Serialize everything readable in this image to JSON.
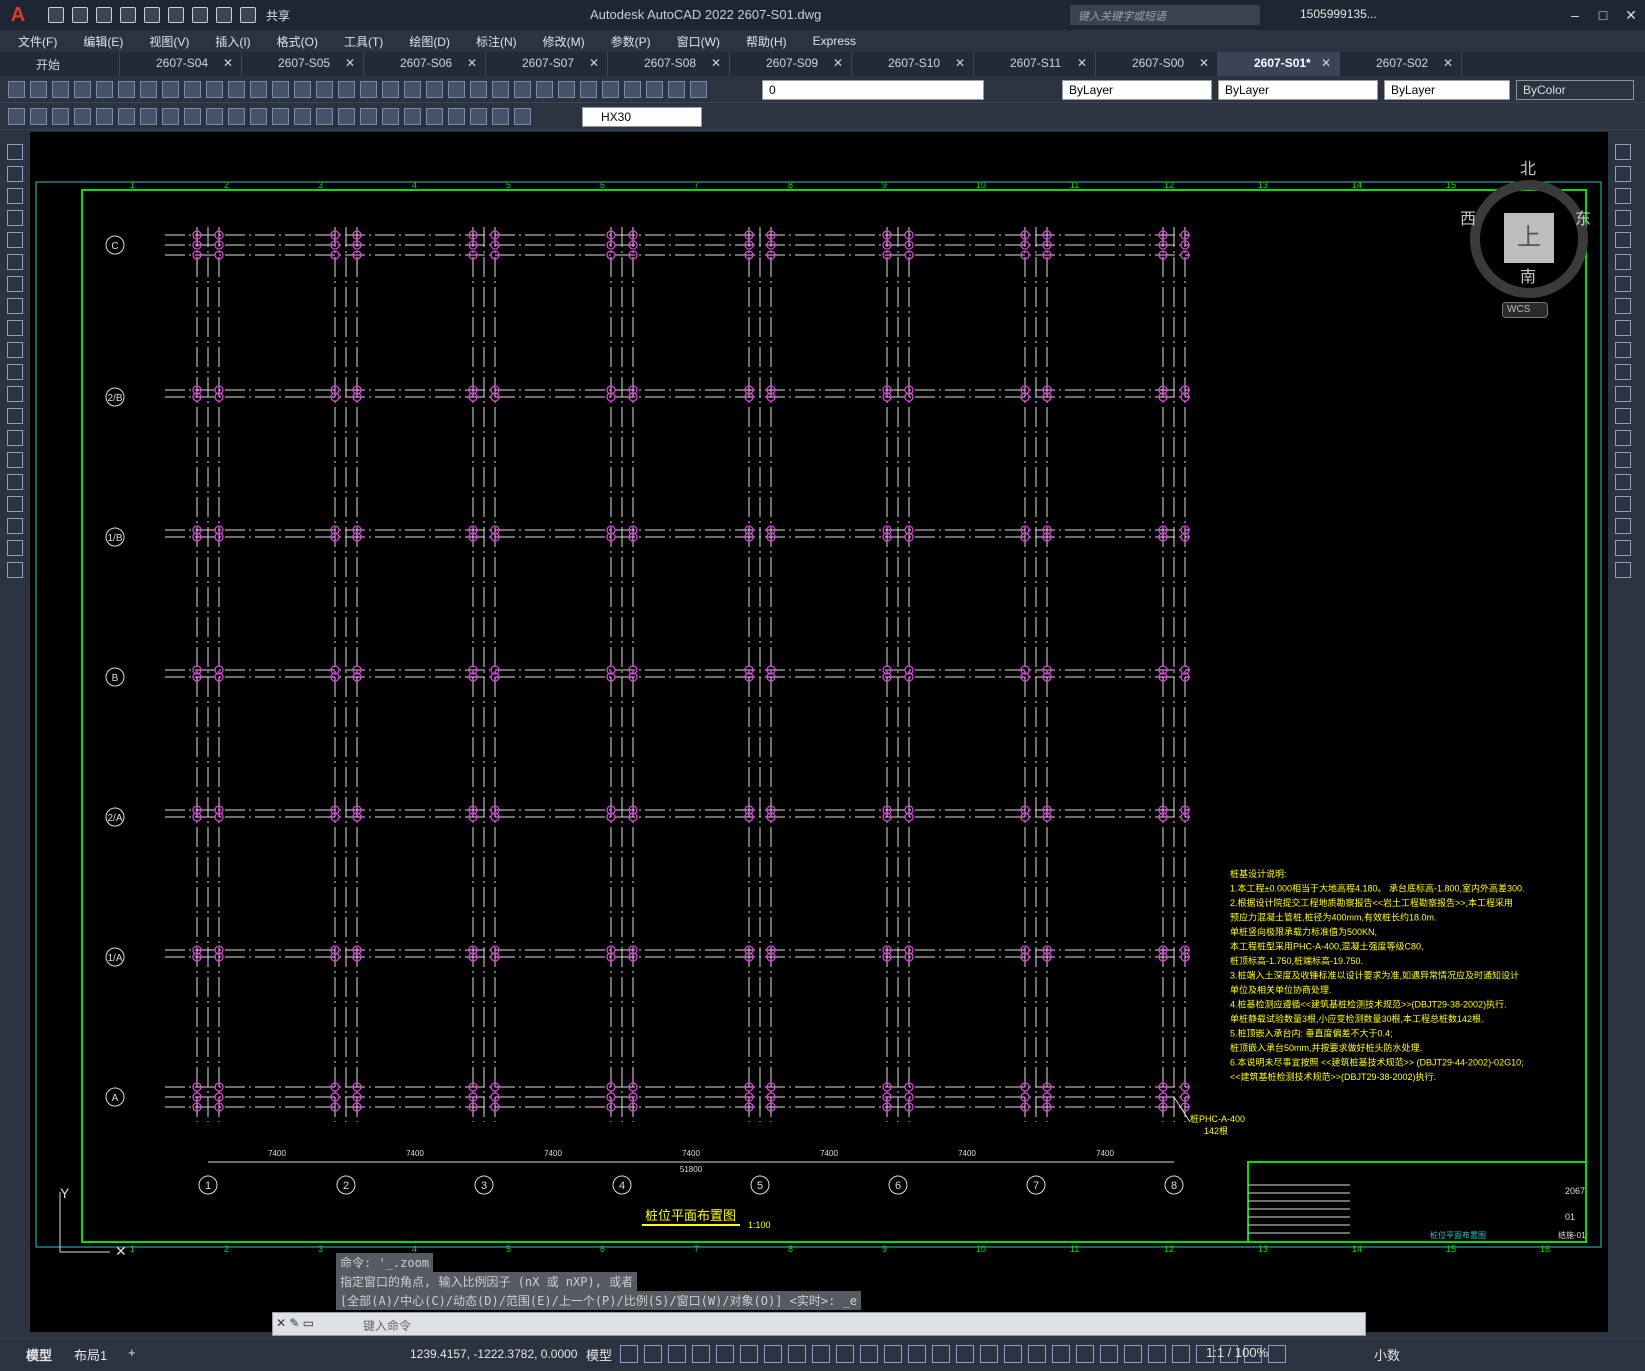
{
  "app": {
    "title": "Autodesk AutoCAD 2022    2607-S01.dwg",
    "logo": "A",
    "share": "共享",
    "search_placeholder": "键入关键字或短语",
    "user": "1505999135..."
  },
  "menu": [
    "文件(F)",
    "编辑(E)",
    "视图(V)",
    "插入(I)",
    "格式(O)",
    "工具(T)",
    "绘图(D)",
    "标注(N)",
    "修改(M)",
    "参数(P)",
    "窗口(W)",
    "帮助(H)",
    "Express"
  ],
  "tabs": [
    {
      "label": "开始",
      "closable": false,
      "active": false
    },
    {
      "label": "2607-S04",
      "closable": true,
      "active": false
    },
    {
      "label": "2607-S05",
      "closable": true,
      "active": false
    },
    {
      "label": "2607-S06",
      "closable": true,
      "active": false
    },
    {
      "label": "2607-S07",
      "closable": true,
      "active": false
    },
    {
      "label": "2607-S08",
      "closable": true,
      "active": false
    },
    {
      "label": "2607-S09",
      "closable": true,
      "active": false
    },
    {
      "label": "2607-S10",
      "closable": true,
      "active": false
    },
    {
      "label": "2607-S11",
      "closable": true,
      "active": false
    },
    {
      "label": "2607-S00",
      "closable": true,
      "active": false
    },
    {
      "label": "2607-S01*",
      "closable": true,
      "active": true
    },
    {
      "label": "2607-S02",
      "closable": true,
      "active": false
    }
  ],
  "properties": {
    "layer": "0",
    "color": "ByLayer",
    "linetype": "ByLayer",
    "lineweight": "ByLayer",
    "plotstyle": "ByColor",
    "textstyle": "HX30"
  },
  "viewcube": {
    "north": "北",
    "south": "南",
    "west": "西",
    "east": "东",
    "top": "上",
    "wcs": "WCS"
  },
  "drawing": {
    "row_labels": [
      "C",
      "2/B",
      "1/B",
      "B",
      "2/A",
      "1/A",
      "A"
    ],
    "col_labels": [
      "1",
      "2",
      "3",
      "4",
      "5",
      "6",
      "7",
      "8"
    ],
    "span_labels": [
      "7400",
      "7400",
      "7400",
      "7400",
      "7400",
      "7400",
      "7400"
    ],
    "total_dim": "51800",
    "title": "桩位平面布置图",
    "scale": "1:100",
    "pile_callout": "桩PHC-A-400",
    "pile_count": "142根",
    "notes": [
      "桩基设计说明:",
      "1.本工程±0.000相当于大地高程4.180。  承台底标高-1.800,室内外高差300.",
      "2.根据设计院提交工程地质勘察报告<<岩土工程勘察报告>>,本工程采用",
      "  预应力混凝土管桩,桩径为400mm,有效桩长约18.0m.",
      "  单桩竖向极限承载力标准值为500KN,",
      "  本工程桩型采用PHC-A-400,混凝土强度等级C80,",
      "  桩顶标高-1.750,桩端标高-19.750.",
      "3.桩端入土深度及收锤标准以设计要求为准,如遇异常情况应及时通知设计",
      "  单位及相关单位协商处理.",
      "4.桩基检测应遵循<<建筑基桩检测技术规范>>(DBJT29-38-2002)执行.",
      "  单桩静载试验数量3根,小应变检测数量30根,本工程总桩数142根.",
      "5.桩顶嵌入承台内:  垂直度偏差不大于0.4;",
      "  桩顶嵌入承台50mm,并按要求做好桩头防水处理.",
      "6.本说明未尽事宜按照  <<建筑桩基技术规范>>   (DBJT29-44-2002)-02G10;",
      "  <<建筑基桩检测技术规范>>(DBJT29-38-2002)执行."
    ],
    "titleblock": {
      "project_no": "2067",
      "sheet": "01",
      "drawing_no": "结施-01",
      "drawing_name": "桩位平面布置图"
    }
  },
  "command": {
    "history": [
      "命令: '_.zoom",
      "指定窗口的角点, 输入比例因子 (nX 或 nXP), 或者",
      "[全部(A)/中心(C)/动态(D)/范围(E)/上一个(P)/比例(S)/窗口(W)/对象(O)] <实时>: _e"
    ],
    "placeholder": "键入命令"
  },
  "status": {
    "model_tab": "模型",
    "layout_tab": "布局1",
    "coords": "1239.4157, -1222.3782, 0.0000",
    "space": "模型",
    "scale": "1:1 / 100%",
    "units": "小数"
  },
  "ucs": {
    "y": "Y"
  }
}
